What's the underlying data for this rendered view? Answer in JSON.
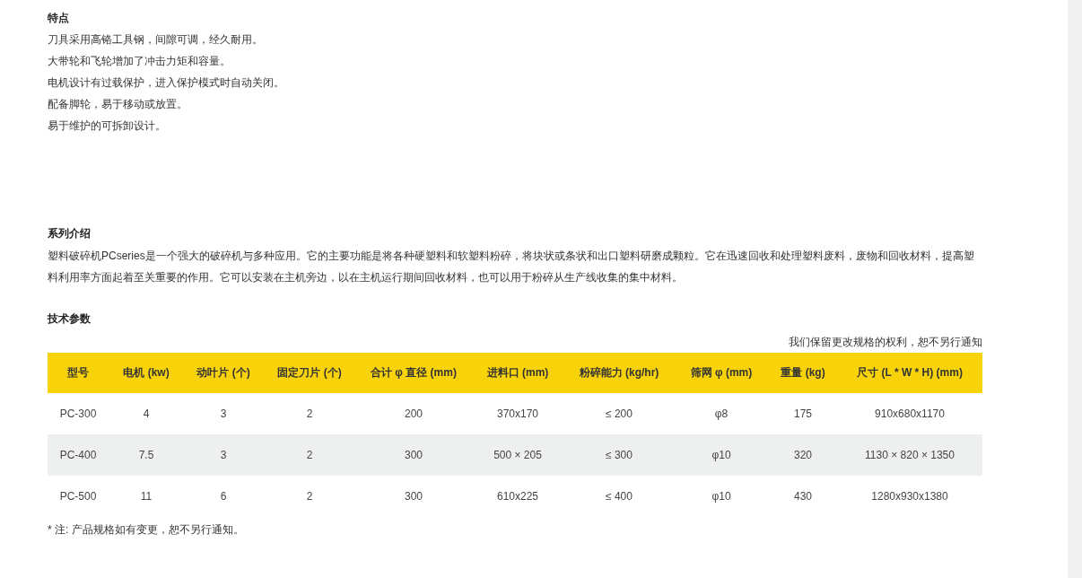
{
  "features": {
    "title": "特点",
    "items": [
      "刀具采用高铬工具钢，间隙可调，经久耐用。",
      "大带轮和飞轮增加了冲击力矩和容量。",
      "电机设计有过载保护，进入保护模式时自动关闭。",
      "配备脚轮，易于移动或放置。",
      "易于维护的可拆卸设计。"
    ]
  },
  "series": {
    "title": "系列介绍",
    "text": "塑料破碎机PCseries是一个强大的破碎机与多种应用。它的主要功能是将各种硬塑料和软塑料粉碎，将块状或条状和出口塑料研磨成颗粒。它在迅速回收和处理塑料废料，废物和回收材料，提高塑料利用率方面起着至关重要的作用。它可以安装在主机旁边，以在主机运行期间回收材料，也可以用于粉碎从生产线收集的集中材料。"
  },
  "specs": {
    "title": "技术参数",
    "notice": "我们保留更改规格的权利，恕不另行通知",
    "table": {
      "columns": [
        "型号",
        "电机 (kw)",
        "动叶片 (个)",
        "固定刀片 (个)",
        "合计 φ 直径 (mm)",
        "进料口 (mm)",
        "粉碎能力 (kg/hr)",
        "筛网 φ (mm)",
        "重量 (kg)",
        "尺寸 (L * W * H) (mm)"
      ],
      "rows": [
        [
          "PC-300",
          "4",
          "3",
          "2",
          "200",
          "370x170",
          "≤ 200",
          "φ8",
          "175",
          "910x680x1170"
        ],
        [
          "PC-400",
          "7.5",
          "3",
          "2",
          "300",
          "500 × 205",
          "≤ 300",
          "φ10",
          "320",
          "1130 × 820 × 1350"
        ],
        [
          "PC-500",
          "11",
          "6",
          "2",
          "300",
          "610x225",
          "≤ 400",
          "φ10",
          "430",
          "1280x930x1380"
        ]
      ]
    },
    "footnote": "* 注: 产品规格如有变更，恕不另行通知。"
  }
}
